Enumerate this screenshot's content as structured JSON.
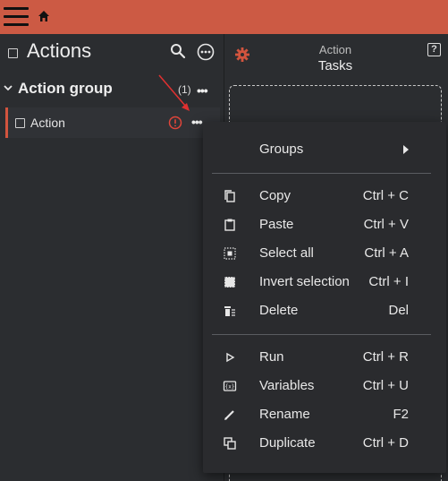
{
  "header": {
    "menu_icon": "hamburger-icon",
    "home_icon": "home-icon",
    "brand_color": "#cc5a44"
  },
  "left_panel": {
    "title": "Actions",
    "group": {
      "label": "Action group",
      "count": "(1)"
    },
    "action": {
      "label": "Action",
      "status_icon": "warning-icon",
      "accent_color": "#d2543e"
    }
  },
  "right_panel": {
    "caption": "Action",
    "title": "Tasks",
    "help_label": "?"
  },
  "context_menu": {
    "groups_label": "Groups",
    "items": [
      {
        "label": "Copy",
        "shortcut": "Ctrl + C",
        "icon": "copy-icon"
      },
      {
        "label": "Paste",
        "shortcut": "Ctrl + V",
        "icon": "paste-icon"
      },
      {
        "label": "Select all",
        "shortcut": "Ctrl + A",
        "icon": "select-all-icon"
      },
      {
        "label": "Invert selection",
        "shortcut": "Ctrl + I",
        "icon": "invert-selection-icon"
      },
      {
        "label": "Delete",
        "shortcut": "Del",
        "icon": "delete-icon"
      },
      {
        "label": "Run",
        "shortcut": "Ctrl + R",
        "icon": "run-icon"
      },
      {
        "label": "Variables",
        "shortcut": "Ctrl + U",
        "icon": "variables-icon"
      },
      {
        "label": "Rename",
        "shortcut": "F2",
        "icon": "rename-icon"
      },
      {
        "label": "Duplicate",
        "shortcut": "Ctrl + D",
        "icon": "duplicate-icon"
      }
    ]
  }
}
